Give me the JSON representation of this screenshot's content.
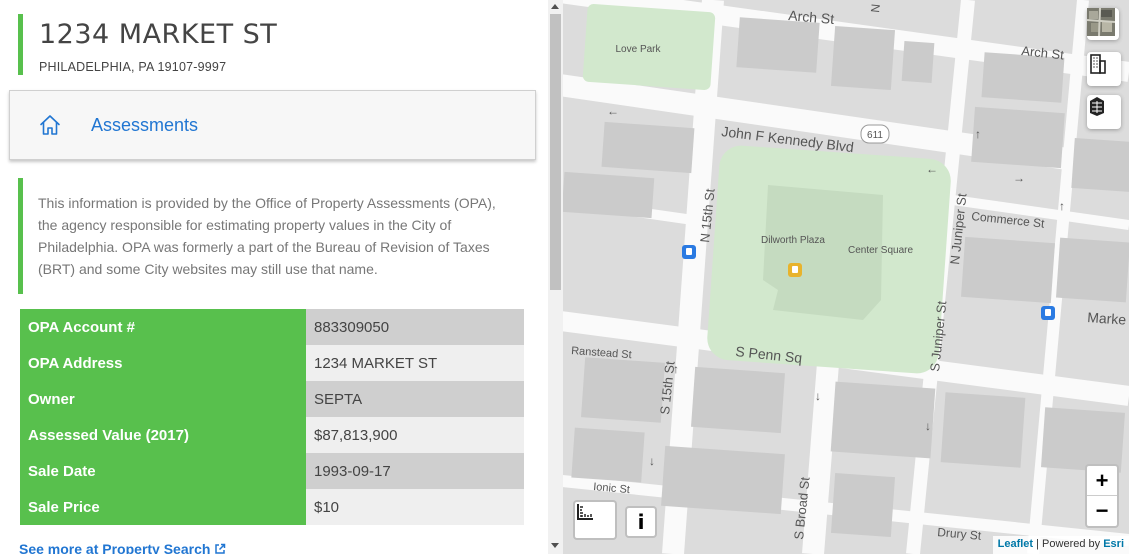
{
  "header": {
    "title": "1234 MARKET ST",
    "subtitle": "PHILADELPHIA, PA 19107-9997"
  },
  "topic": {
    "label": "Assessments",
    "icon": "home-icon"
  },
  "description": "This information is provided by the Office of Property Assessments (OPA), the agency responsible for estimating property values in the City of Philadelphia. OPA was formerly a part of the Bureau of Revision of Taxes (BRT) and some City websites may still use that name.",
  "property_table": [
    {
      "label": "OPA Account #",
      "value": "883309050"
    },
    {
      "label": "OPA Address",
      "value": "1234 MARKET ST"
    },
    {
      "label": "Owner",
      "value": "SEPTA"
    },
    {
      "label": "Assessed Value (2017)",
      "value": "$87,813,900"
    },
    {
      "label": "Sale Date",
      "value": "1993-09-17"
    },
    {
      "label": "Sale Price",
      "value": "$10"
    }
  ],
  "see_more_link": "See more at Property Search",
  "map": {
    "labels": {
      "arch_st_1": "Arch St",
      "arch_st_2": "Arch St",
      "love_park": "Love Park",
      "jfk_blvd": "John F Kennedy Blvd",
      "route_611": "611",
      "n_15th_st": "N 15th St",
      "dilworth_plaza": "Dilworth Plaza",
      "center_square": "Center Square",
      "n_juniper_st": "N Juniper St",
      "commerce_st": "Commerce St",
      "s_juniper_st": "S Juniper St",
      "market": "Marke",
      "ranstead_st": "Ranstead St",
      "s_penn_sq": "S Penn Sq",
      "s_15th_st": "S 15th St",
      "s_broad_st": "S Broad St",
      "ionic_st": "Ionic St",
      "drury_st": "Drury St",
      "n_label": "N"
    },
    "zoom_in": "+",
    "zoom_out": "−",
    "info_button": "i",
    "attribution": {
      "leaflet": "Leaflet",
      "sep": " | Powered by ",
      "esri": "Esri"
    },
    "colors": {
      "park": "#d2e8cd",
      "block": "#c9c9c9",
      "street": "#fafafa",
      "accent_green": "#58c04d",
      "link_blue": "#2176d2"
    }
  }
}
